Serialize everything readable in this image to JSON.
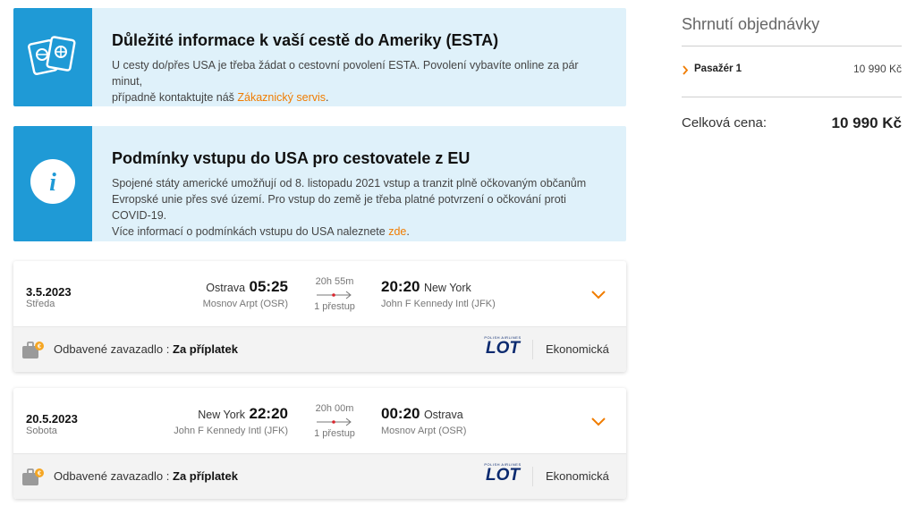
{
  "info_esta": {
    "title": "Důležité informace k vaší cestě do Ameriky (ESTA)",
    "text_line1": "U cesty do/přes USA je třeba žádat o cestovní povolení ESTA. Povolení vybavíte online za pár minut,",
    "text_line2_prefix": "případně kontaktujte náš ",
    "link": "Zákaznický servis",
    "text_line2_suffix": "."
  },
  "info_covid": {
    "title": "Podmínky vstupu do USA pro cestovatele z EU",
    "text_line1": "Spojené státy americké umožňují od 8. listopadu 2021 vstup a tranzit plně očkovaným občanům",
    "text_line2": "Evropské unie přes své území. Pro vstup do země je třeba platné potvrzení o očkování proti COVID-19.",
    "text_line3_prefix": "Více informací o podmínkách vstupu do USA naleznete ",
    "link": "zde",
    "text_line3_suffix": "."
  },
  "flights": [
    {
      "date": "3.5.2023",
      "day": "Středa",
      "dep_city": "Ostrava",
      "dep_time": "05:25",
      "dep_airport": "Mosnov Arpt (OSR)",
      "duration": "20h 55m",
      "stops": "1 přestup",
      "arr_time": "20:20",
      "arr_city": "New York",
      "arr_airport": "John F Kennedy Intl (JFK)",
      "baggage_label": "Odbavené zavazadlo :",
      "baggage_value": "Za příplatek",
      "airline_logo": "LOT",
      "airline_small": "POLISH AIRLINES",
      "cabin_class": "Ekonomická"
    },
    {
      "date": "20.5.2023",
      "day": "Sobota",
      "dep_city": "New York",
      "dep_time": "22:20",
      "dep_airport": "John F Kennedy Intl (JFK)",
      "duration": "20h 00m",
      "stops": "1 přestup",
      "arr_time": "00:20",
      "arr_city": "Ostrava",
      "arr_airport": "Mosnov Arpt (OSR)",
      "baggage_label": "Odbavené zavazadlo :",
      "baggage_value": "Za příplatek",
      "airline_logo": "LOT",
      "airline_small": "POLISH AIRLINES",
      "cabin_class": "Ekonomická"
    }
  ],
  "summary": {
    "title": "Shrnutí objednávky",
    "passenger_label": "Pasažér 1",
    "passenger_price": "10 990 Kč",
    "total_label": "Celková cena:",
    "total_price": "10 990 Kč"
  },
  "colors": {
    "accent": "#f07c00",
    "info_bg": "#dff1fa",
    "info_icon_bg": "#1f9ad6",
    "lot_blue": "#0b2a6f"
  }
}
